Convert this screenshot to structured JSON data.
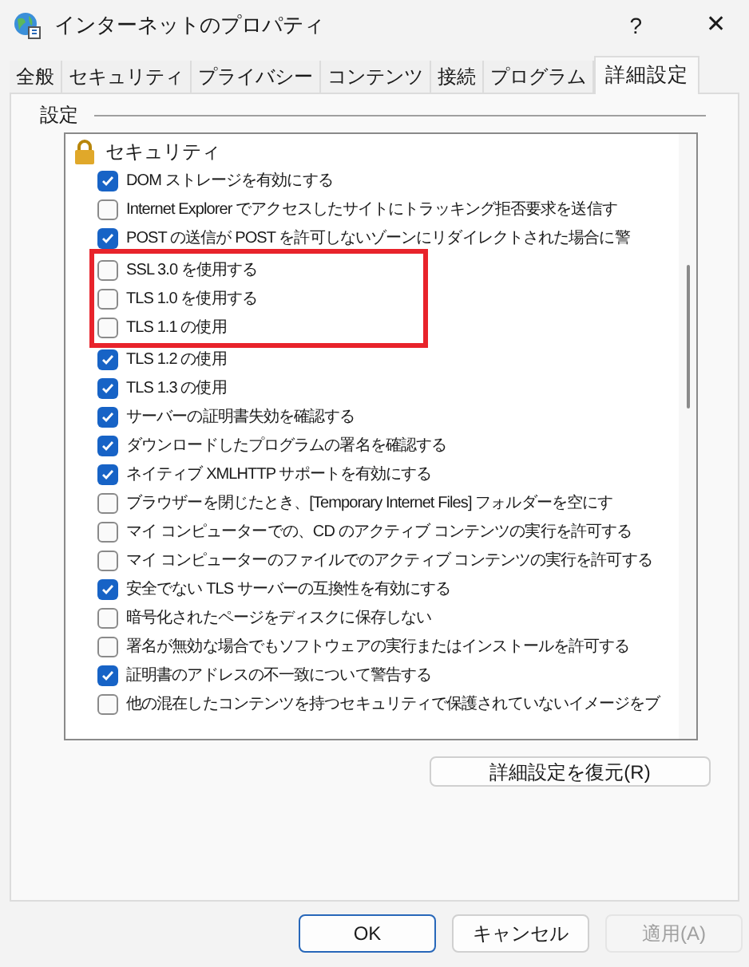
{
  "window": {
    "title": "インターネットのプロパティ",
    "help": "?",
    "close": "✕"
  },
  "tabs": [
    {
      "label": "全般",
      "selected": false
    },
    {
      "label": "セキュリティ",
      "selected": false
    },
    {
      "label": "プライバシー",
      "selected": false
    },
    {
      "label": "コンテンツ",
      "selected": false
    },
    {
      "label": "接続",
      "selected": false
    },
    {
      "label": "プログラム",
      "selected": false
    },
    {
      "label": "詳細設定",
      "selected": true
    }
  ],
  "group_label": "設定",
  "settings": {
    "category": "セキュリティ",
    "items": [
      {
        "label": "DOM ストレージを有効にする",
        "checked": true,
        "highlighted": false
      },
      {
        "label": "Internet Explorer でアクセスしたサイトにトラッキング拒否要求を送信す",
        "checked": false,
        "highlighted": false
      },
      {
        "label": "POST の送信が POST を許可しないゾーンにリダイレクトされた場合に警",
        "checked": true,
        "highlighted": false
      },
      {
        "label": "SSL 3.0 を使用する",
        "checked": false,
        "highlighted": true
      },
      {
        "label": "TLS 1.0 を使用する",
        "checked": false,
        "highlighted": true
      },
      {
        "label": "TLS 1.1 の使用",
        "checked": false,
        "highlighted": true
      },
      {
        "label": "TLS 1.2 の使用",
        "checked": true,
        "highlighted": false
      },
      {
        "label": "TLS 1.3 の使用",
        "checked": true,
        "highlighted": false
      },
      {
        "label": "サーバーの証明書失効を確認する",
        "checked": true,
        "highlighted": false
      },
      {
        "label": "ダウンロードしたプログラムの署名を確認する",
        "checked": true,
        "highlighted": false
      },
      {
        "label": "ネイティブ XMLHTTP サポートを有効にする",
        "checked": true,
        "highlighted": false
      },
      {
        "label": "ブラウザーを閉じたとき、[Temporary Internet Files] フォルダーを空にす",
        "checked": false,
        "highlighted": false
      },
      {
        "label": "マイ コンピューターでの、CD のアクティブ コンテンツの実行を許可する",
        "checked": false,
        "highlighted": false
      },
      {
        "label": "マイ コンピューターのファイルでのアクティブ コンテンツの実行を許可する",
        "checked": false,
        "highlighted": false
      },
      {
        "label": "安全でない TLS サーバーの互換性を有効にする",
        "checked": true,
        "highlighted": false
      },
      {
        "label": "暗号化されたページをディスクに保存しない",
        "checked": false,
        "highlighted": false
      },
      {
        "label": "署名が無効な場合でもソフトウェアの実行またはインストールを許可する",
        "checked": false,
        "highlighted": false
      },
      {
        "label": "証明書のアドレスの不一致について警告する",
        "checked": true,
        "highlighted": false
      },
      {
        "label": "他の混在したコンテンツを持つセキュリティで保護されていないイメージをブ",
        "checked": false,
        "highlighted": false
      }
    ]
  },
  "restore_button": "詳細設定を復元(R)",
  "buttons": [
    {
      "label": "OK",
      "kind": "default",
      "disabled": false
    },
    {
      "label": "キャンセル",
      "kind": "normal",
      "disabled": false
    },
    {
      "label": "適用(A)",
      "kind": "normal",
      "disabled": true
    }
  ]
}
